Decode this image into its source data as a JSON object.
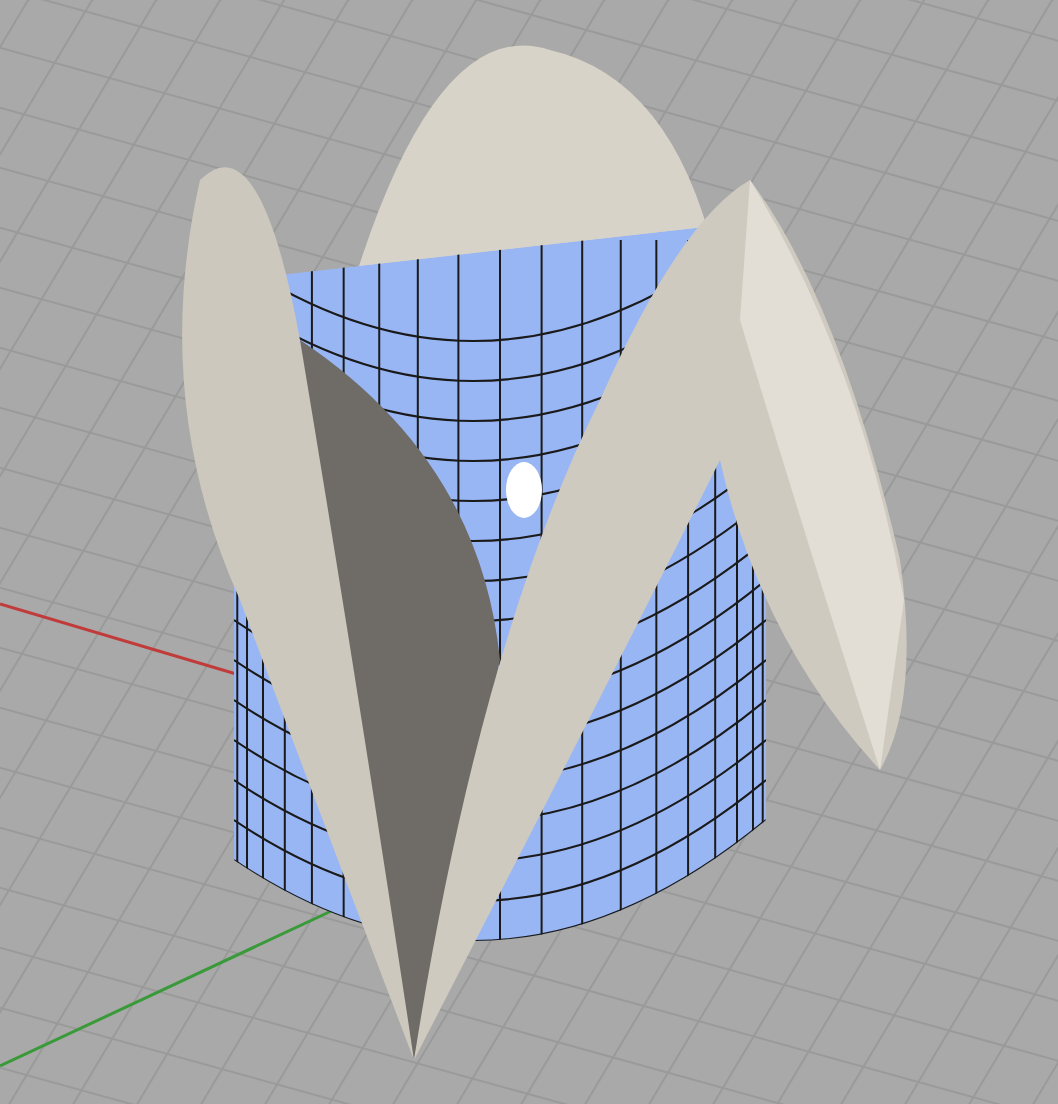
{
  "viewport": {
    "axes": [
      {
        "kind": "x",
        "color": "#c23b3b"
      },
      {
        "kind": "y",
        "color": "#3a9a3a"
      }
    ]
  }
}
